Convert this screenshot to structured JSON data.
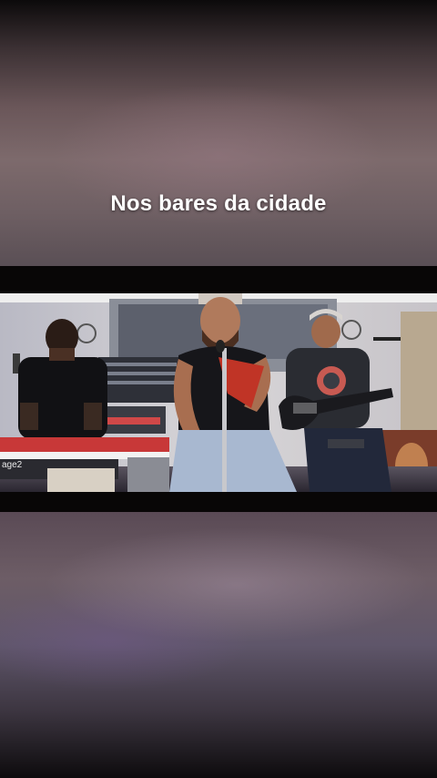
{
  "caption": "Nos bares da cidade",
  "keyboard_brand": "age2"
}
